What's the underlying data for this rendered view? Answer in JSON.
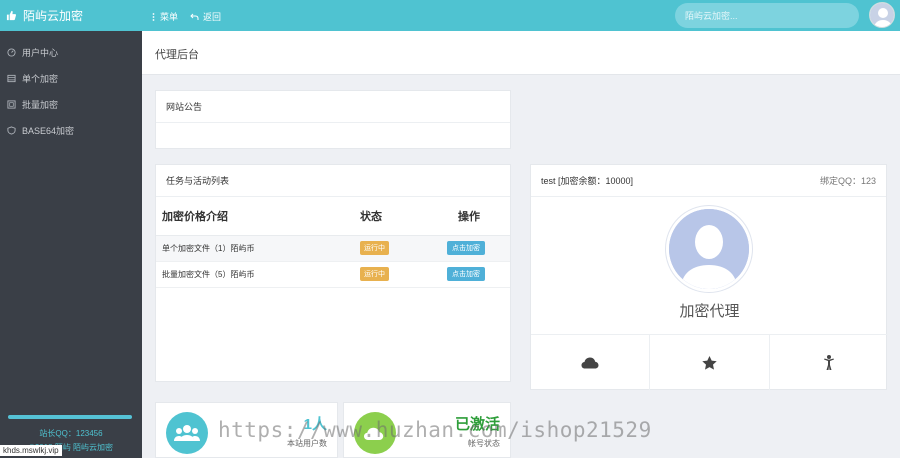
{
  "sidebar": {
    "brand": "陌屿云加密",
    "items": [
      {
        "label": "用户中心",
        "icon": "gauge-icon"
      },
      {
        "label": "单个加密",
        "icon": "list-icon"
      },
      {
        "label": "批量加密",
        "icon": "grid-icon"
      },
      {
        "label": "BASE64加密",
        "icon": "shield-icon"
      }
    ],
    "qq": "站长QQ：123456",
    "copyright": "©2018 陌屿 陌屿云加密",
    "url": "khds.mswlkj.vip"
  },
  "header": {
    "menu_label": "菜单",
    "back_label": "返回",
    "search_placeholder": "陌屿云加密..."
  },
  "page": {
    "title": "代理后台"
  },
  "notice": {
    "title": "网站公告"
  },
  "tasks": {
    "title": "任务与活动列表",
    "columns": [
      "加密价格介绍",
      "状态",
      "操作"
    ],
    "rows": [
      {
        "desc": "单个加密文件（1）陌屿币",
        "status": "运行中",
        "action": "点击加密"
      },
      {
        "desc": "批量加密文件（5）陌屿币",
        "status": "运行中",
        "action": "点击加密"
      }
    ]
  },
  "profile": {
    "user": "test [加密余额：10000]",
    "qq": "绑定QQ：123",
    "name": "加密代理"
  },
  "stats": [
    {
      "value": "1人",
      "label": "本站用户数",
      "color": "#4fc3d1"
    },
    {
      "value": "已激活",
      "label": "帐号状态",
      "color": "#2e9e3a"
    }
  ],
  "watermark": "https://www.huzhan.com/ishop21529",
  "colors": {
    "accent": "#4fc3d1",
    "sidebar": "#3a3f47",
    "badge": "#e8b14f",
    "button": "#4fb0d8"
  }
}
